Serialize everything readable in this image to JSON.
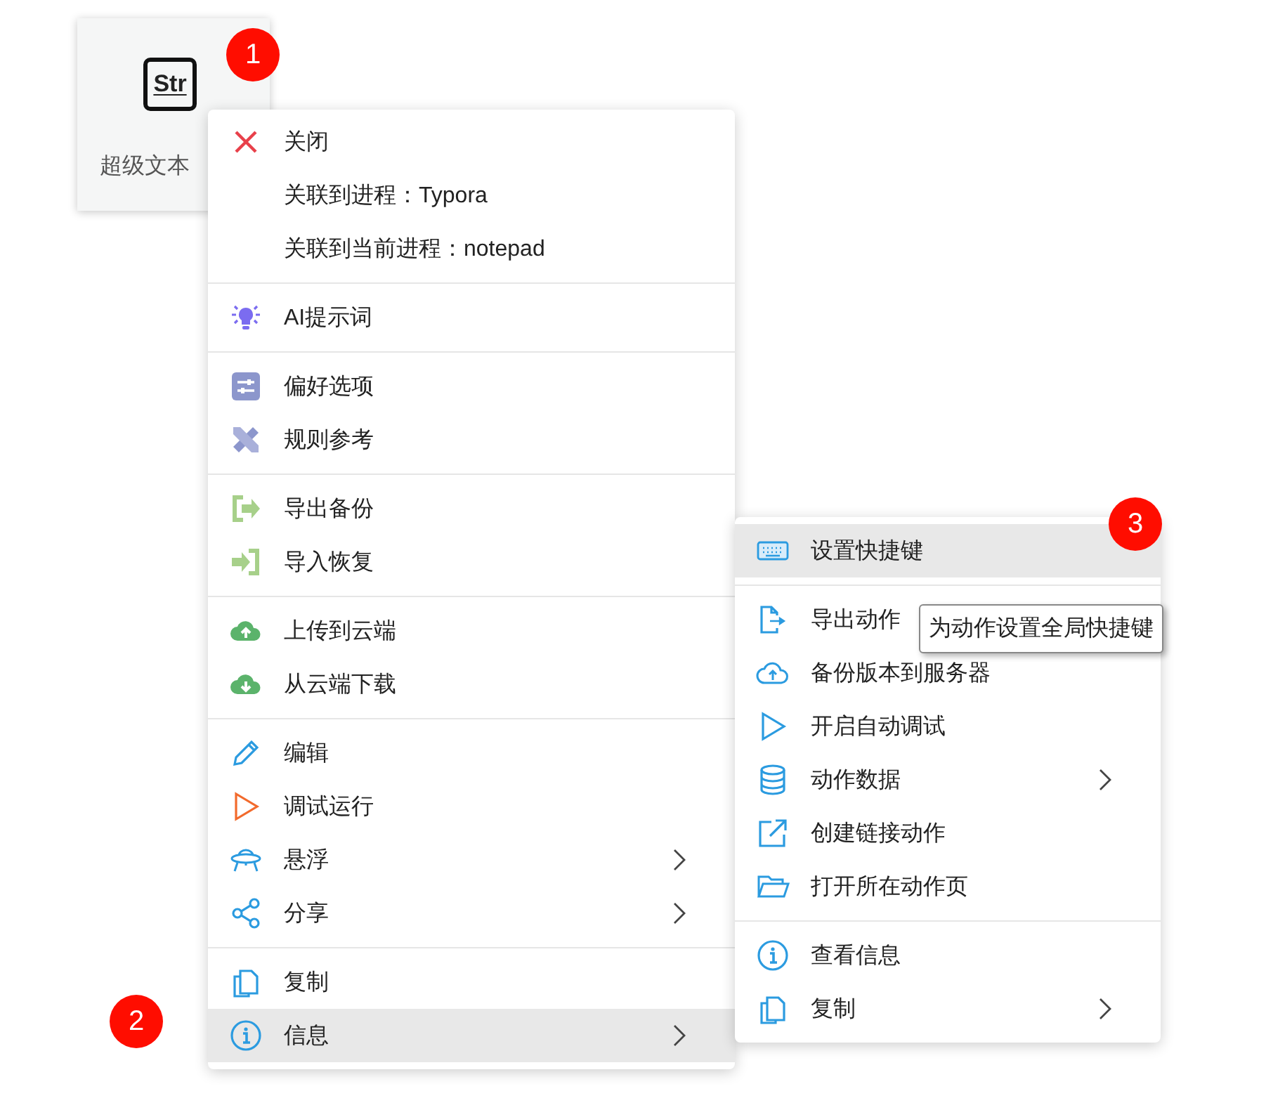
{
  "card": {
    "icon_text": "Str",
    "label": "超级文本"
  },
  "badges": [
    "1",
    "2",
    "3"
  ],
  "menu": {
    "groups": [
      [
        {
          "label": "关闭",
          "selected": false,
          "submenu": false
        },
        {
          "label": "关联到进程：Typora",
          "selected": false,
          "submenu": false
        },
        {
          "label": "关联到当前进程：notepad",
          "selected": false,
          "submenu": false
        }
      ],
      [
        {
          "label": "AI提示词",
          "selected": false,
          "submenu": false
        }
      ],
      [
        {
          "label": "偏好选项",
          "selected": false,
          "submenu": false
        },
        {
          "label": "规则参考",
          "selected": false,
          "submenu": false
        }
      ],
      [
        {
          "label": "导出备份",
          "selected": false,
          "submenu": false
        },
        {
          "label": "导入恢复",
          "selected": false,
          "submenu": false
        }
      ],
      [
        {
          "label": "上传到云端",
          "selected": false,
          "submenu": false
        },
        {
          "label": "从云端下载",
          "selected": false,
          "submenu": false
        }
      ],
      [
        {
          "label": "编辑",
          "selected": false,
          "submenu": false
        },
        {
          "label": "调试运行",
          "selected": false,
          "submenu": false
        },
        {
          "label": "悬浮",
          "selected": false,
          "submenu": true
        },
        {
          "label": "分享",
          "selected": false,
          "submenu": true
        }
      ],
      [
        {
          "label": "复制",
          "selected": false,
          "submenu": false
        },
        {
          "label": "信息",
          "selected": true,
          "submenu": true
        }
      ]
    ]
  },
  "submenu": {
    "groups": [
      [
        {
          "label": "设置快捷键",
          "selected": true,
          "submenu": false
        }
      ],
      [
        {
          "label": "导出动作",
          "selected": false,
          "submenu": false
        },
        {
          "label": "备份版本到服务器",
          "selected": false,
          "submenu": false
        },
        {
          "label": "开启自动调试",
          "selected": false,
          "submenu": false
        },
        {
          "label": "动作数据",
          "selected": false,
          "submenu": true
        },
        {
          "label": "创建链接动作",
          "selected": false,
          "submenu": false
        },
        {
          "label": "打开所在动作页",
          "selected": false,
          "submenu": false
        }
      ],
      [
        {
          "label": "查看信息",
          "selected": false,
          "submenu": false
        },
        {
          "label": "复制",
          "selected": false,
          "submenu": true
        }
      ]
    ]
  },
  "tooltip": "为动作设置全局快捷键"
}
